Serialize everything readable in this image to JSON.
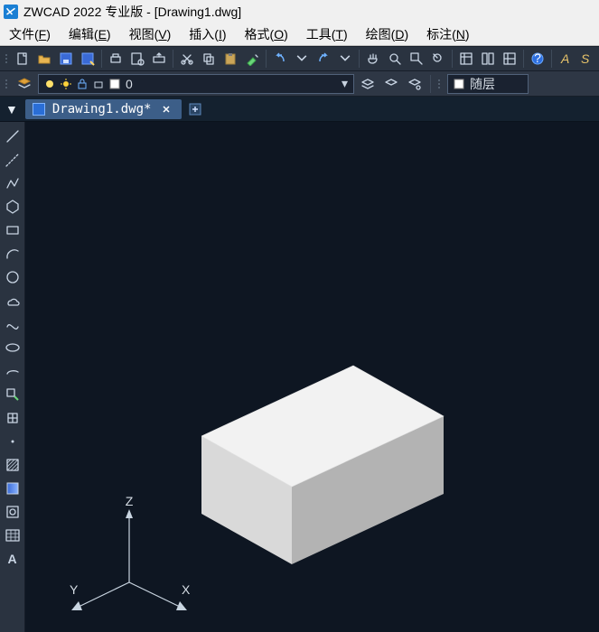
{
  "title": "ZWCAD 2022 专业版 - [Drawing1.dwg]",
  "menus": [
    {
      "label": "文件",
      "key": "F"
    },
    {
      "label": "编辑",
      "key": "E"
    },
    {
      "label": "视图",
      "key": "V"
    },
    {
      "label": "插入",
      "key": "I"
    },
    {
      "label": "格式",
      "key": "O"
    },
    {
      "label": "工具",
      "key": "T"
    },
    {
      "label": "绘图",
      "key": "D"
    },
    {
      "label": "标注",
      "key": "N"
    }
  ],
  "layer": {
    "current": "0",
    "style_label": "随层"
  },
  "document": {
    "tab_name": "Drawing1.dwg*"
  },
  "axis": {
    "x": "X",
    "y": "Y",
    "z": "Z"
  },
  "toolbar_right_text": "S",
  "text_tool_label": "A"
}
